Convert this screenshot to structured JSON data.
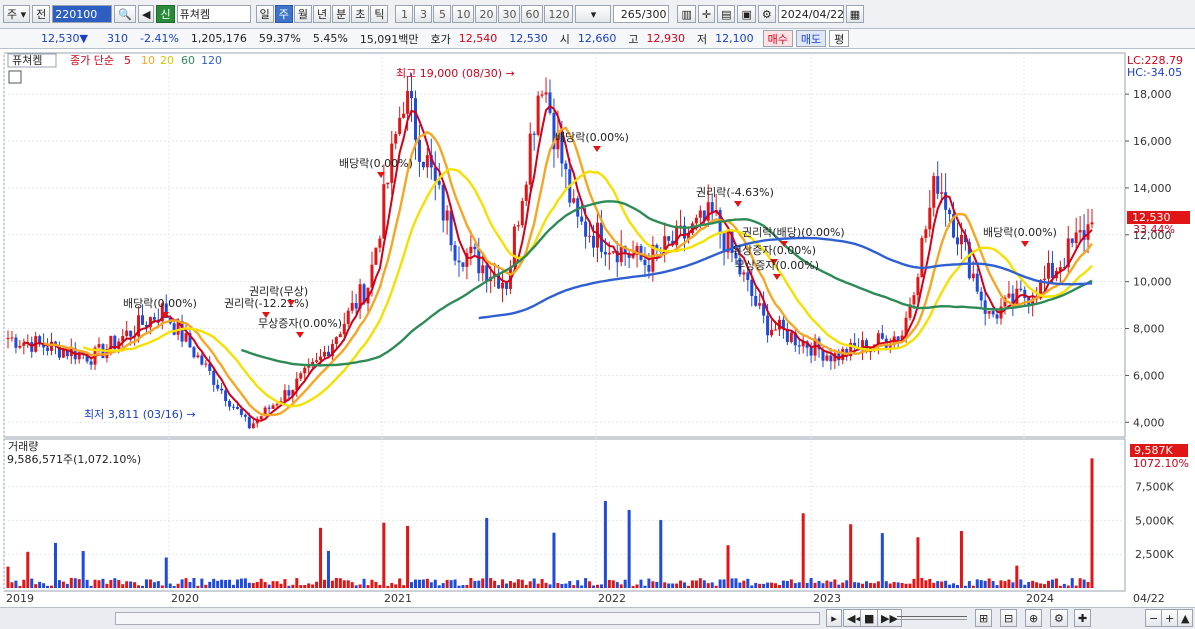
{
  "toolbar": {
    "period_dropdown": "주",
    "prev_label": "전",
    "code": "220100",
    "new_badge": "신",
    "stock_name": "퓨쳐켐",
    "tabs": [
      "일",
      "주",
      "월",
      "년",
      "분",
      "초",
      "틱"
    ],
    "selected_tab": "주",
    "intervals": [
      "1",
      "3",
      "5",
      "10",
      "20",
      "30",
      "60",
      "120"
    ],
    "count": "265",
    "count_total": "/300",
    "date": "2024/04/22"
  },
  "quote": {
    "price": "12,530",
    "change_arrow": "▼",
    "change": "310",
    "change_pct": "-2.41%",
    "volume": "1,205,176",
    "vol_ratio": "59.37%",
    "turnover": "5.45%",
    "amount": "15,091백만",
    "ask_label": "호가",
    "ask": "12,540",
    "bid": "12,530",
    "open_label": "시",
    "open": "12,660",
    "high_label": "고",
    "high": "12,930",
    "low_label": "저",
    "low": "12,100",
    "buy_label": "매수",
    "sell_label": "매도",
    "eval_label": "평"
  },
  "price_panel": {
    "stock_tag": "퓨쳐켐",
    "legend_main": "종가 단순",
    "ma_labels": [
      "5",
      "10",
      "20",
      "60",
      "120"
    ],
    "ma_colors": [
      "#d0021b",
      "#f5a623",
      "#f5e000",
      "#2e8b57",
      "#3060d0"
    ],
    "lc": "LC:228.79",
    "hc": "HC:-34.05",
    "current_price": "12,530",
    "current_pct": "33.44%",
    "y_ticks": [
      "18,000",
      "16,000",
      "14,000",
      "12,000",
      "10,000",
      "8,000",
      "6,000",
      "4,000"
    ],
    "high_note": "최고 19,000 (08/30) →",
    "low_note": "최저 3,811 (03/16) →",
    "annotations": [
      "배당락(0.00%)",
      "권리락(-12.21%)",
      "권리락(무상)",
      "무상증자(0.00%)",
      "배당락(0.00%)",
      "배당락(0.00%)",
      "권리락(-4.63%)",
      "권리락(배당)(0.00%)",
      "유상증자(0.00%)",
      "무상증자(0.00%)",
      "배당락(0.00%)"
    ]
  },
  "volume_panel": {
    "title": "거래량",
    "summary": "9,586,571주(1,072.10%)",
    "current": "9,587K",
    "current_pct": "1072.10%",
    "y_ticks": [
      "7,500K",
      "5,000K",
      "2,500K"
    ]
  },
  "x_axis": {
    "labels": [
      "2019",
      "2020",
      "2021",
      "2022",
      "2023",
      "2024"
    ],
    "end_label": "04/22"
  },
  "chart_data": {
    "type": "candlestick",
    "interval": "weekly",
    "price_range": [
      3500,
      19500
    ],
    "volume_range": [
      0,
      10500
    ],
    "closes_anchor": [
      {
        "date": "2019-01",
        "close": 7600
      },
      {
        "date": "2019-06",
        "close": 6800
      },
      {
        "date": "2019-10",
        "close": 8800
      },
      {
        "date": "2020-03",
        "close": 3811
      },
      {
        "date": "2020-07",
        "close": 6500
      },
      {
        "date": "2020-10",
        "close": 10000
      },
      {
        "date": "2020-12",
        "close": 18000
      },
      {
        "date": "2021-03",
        "close": 11500
      },
      {
        "date": "2021-06",
        "close": 10000
      },
      {
        "date": "2021-08",
        "close": 19000
      },
      {
        "date": "2021-10",
        "close": 12500
      },
      {
        "date": "2022-02",
        "close": 10800
      },
      {
        "date": "2022-06",
        "close": 12800
      },
      {
        "date": "2022-09",
        "close": 8200
      },
      {
        "date": "2023-01",
        "close": 6800
      },
      {
        "date": "2023-05",
        "close": 7800
      },
      {
        "date": "2023-07",
        "close": 14500
      },
      {
        "date": "2023-10",
        "close": 8500
      },
      {
        "date": "2024-01",
        "close": 9800
      },
      {
        "date": "2024-04",
        "close": 12530
      }
    ],
    "last_volume_k": 9587
  }
}
